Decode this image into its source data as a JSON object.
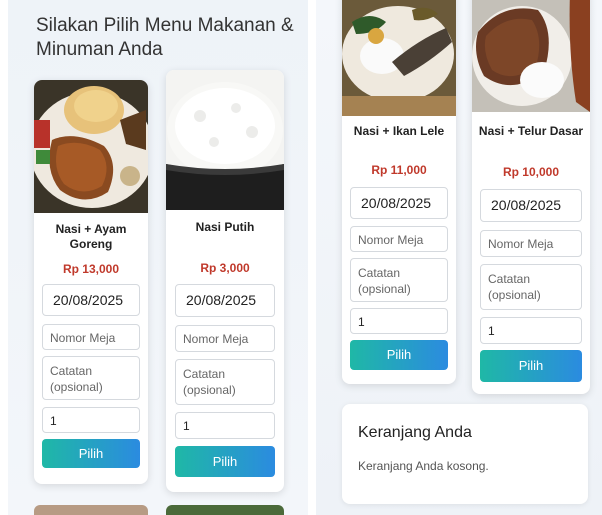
{
  "page": {
    "title": "Silakan Pilih Menu Makanan & Minuman Anda"
  },
  "colors": {
    "price": "#c0392b",
    "button_start": "#1fb8a6",
    "button_end": "#2b8be0"
  },
  "left_menu": [
    {
      "name": "Nasi + Ayam Goreng",
      "price": "Rp 13,000",
      "date": "20/08/2025",
      "table_placeholder": "Nomor Meja",
      "note_placeholder": "Catatan (opsional)",
      "qty": "1",
      "button": "Pilih"
    },
    {
      "name": "Nasi Putih",
      "price": "Rp 3,000",
      "date": "20/08/2025",
      "table_placeholder": "Nomor Meja",
      "note_placeholder": "Catatan (opsional)",
      "qty": "1",
      "button": "Pilih"
    }
  ],
  "right_menu": [
    {
      "name": "Nasi + Ikan Lele",
      "price": "Rp 11,000",
      "date": "20/08/2025",
      "table_placeholder": "Nomor Meja",
      "note_placeholder": "Catatan (opsional)",
      "qty": "1",
      "button": "Pilih"
    },
    {
      "name": "Nasi + Telur Dasar",
      "price": "Rp 10,000",
      "date": "20/08/2025",
      "table_placeholder": "Nomor Meja",
      "note_placeholder": "Catatan (opsional)",
      "qty": "1",
      "button": "Pilih"
    }
  ],
  "cart": {
    "title": "Keranjang Anda",
    "empty_text": "Keranjang Anda kosong."
  }
}
